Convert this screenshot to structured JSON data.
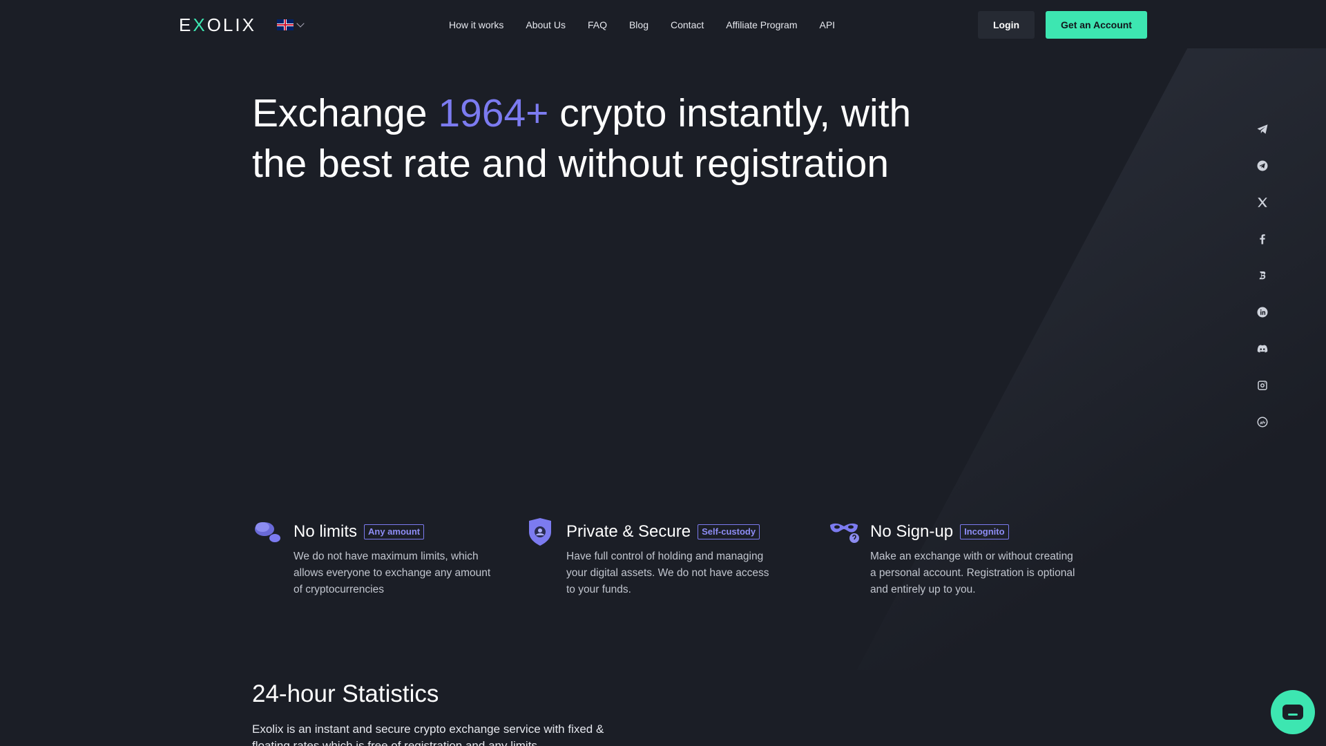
{
  "header": {
    "logo_prefix": "E",
    "logo_x": "X",
    "logo_suffix": "OLIX",
    "language": "en-GB flag",
    "nav": [
      "How it works",
      "About Us",
      "FAQ",
      "Blog",
      "Contact",
      "Affiliate Program",
      "API"
    ],
    "login_label": "Login",
    "account_label": "Get an Account"
  },
  "hero": {
    "title_before": "Exchange ",
    "title_accent": "1964+",
    "title_after": " crypto instantly, with the best rate and without registration"
  },
  "socials": [
    "telegram-icon",
    "telegram-chat-icon",
    "x-icon",
    "facebook-icon",
    "bitcointalk-icon",
    "linkedin-icon",
    "discord-icon",
    "instagram-icon",
    "coinmarketcap-icon"
  ],
  "features": [
    {
      "icon": "coins-icon",
      "title": "No limits",
      "badge": "Any amount",
      "desc": "We do not have maximum limits, which allows everyone to exchange any amount of cryptocurrencies"
    },
    {
      "icon": "shield-icon",
      "title": "Private & Secure",
      "badge": "Self-custody",
      "desc": "Have full control of holding and managing your digital assets. We do not have access to your funds."
    },
    {
      "icon": "mask-icon",
      "title": "No Sign-up",
      "badge": "Incognito",
      "desc": "Make an exchange with or without creating a personal account. Registration is optional and entirely up to you."
    }
  ],
  "stats": {
    "title": "24-hour Statistics",
    "desc": "Exolix is an instant and secure crypto exchange service with fixed & floating rates which is free of registration and any limits."
  },
  "colors": {
    "background": "#1b1e26",
    "accent_green": "#3de6b1",
    "accent_purple": "#7c7bf0"
  }
}
